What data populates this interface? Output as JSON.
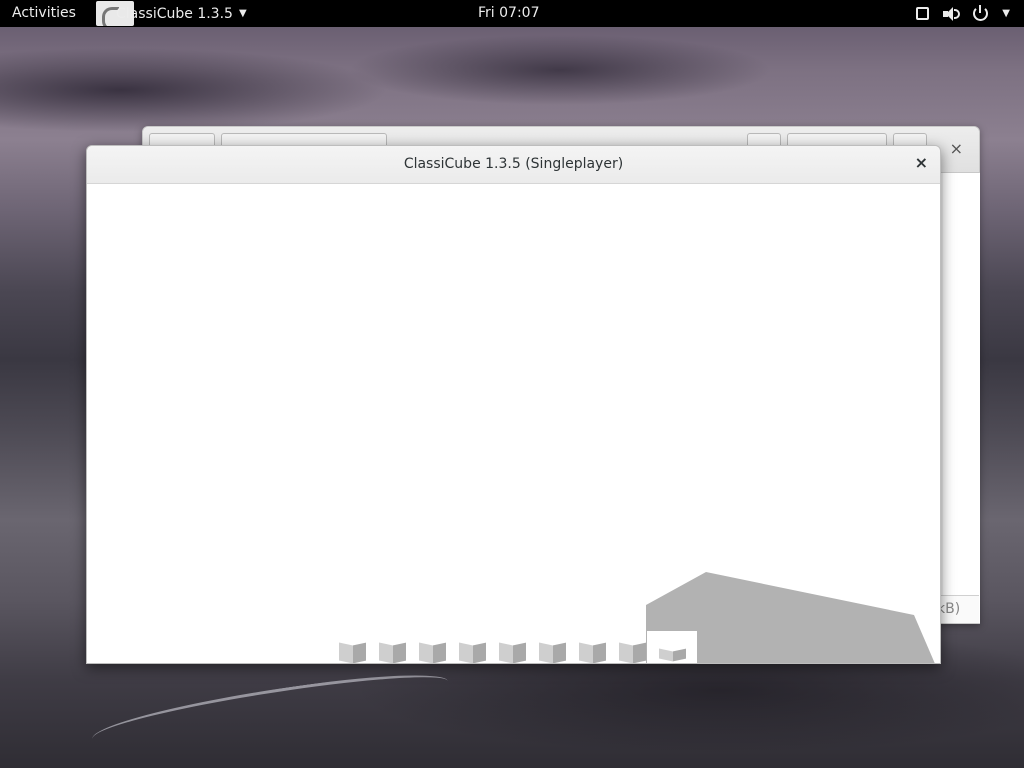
{
  "topbar": {
    "activities": "Activities",
    "app_name": "ClassiCube 1.3.5",
    "clock": "Fri 07:07",
    "tray_icons": [
      "window-square-icon",
      "volume-icon",
      "power-icon",
      "chevron-down-icon"
    ]
  },
  "background_window": {
    "status_text": "kB)"
  },
  "main_window": {
    "title": "ClassiCube 1.3.5 (Singleplayer)",
    "close_glyph": "×"
  },
  "hotbar": {
    "slot_count": 9,
    "selected_slot": 9
  },
  "colors": {
    "topbar_bg": "#000000",
    "terrain": "#b2b2b2",
    "sky": "#ffffff"
  }
}
